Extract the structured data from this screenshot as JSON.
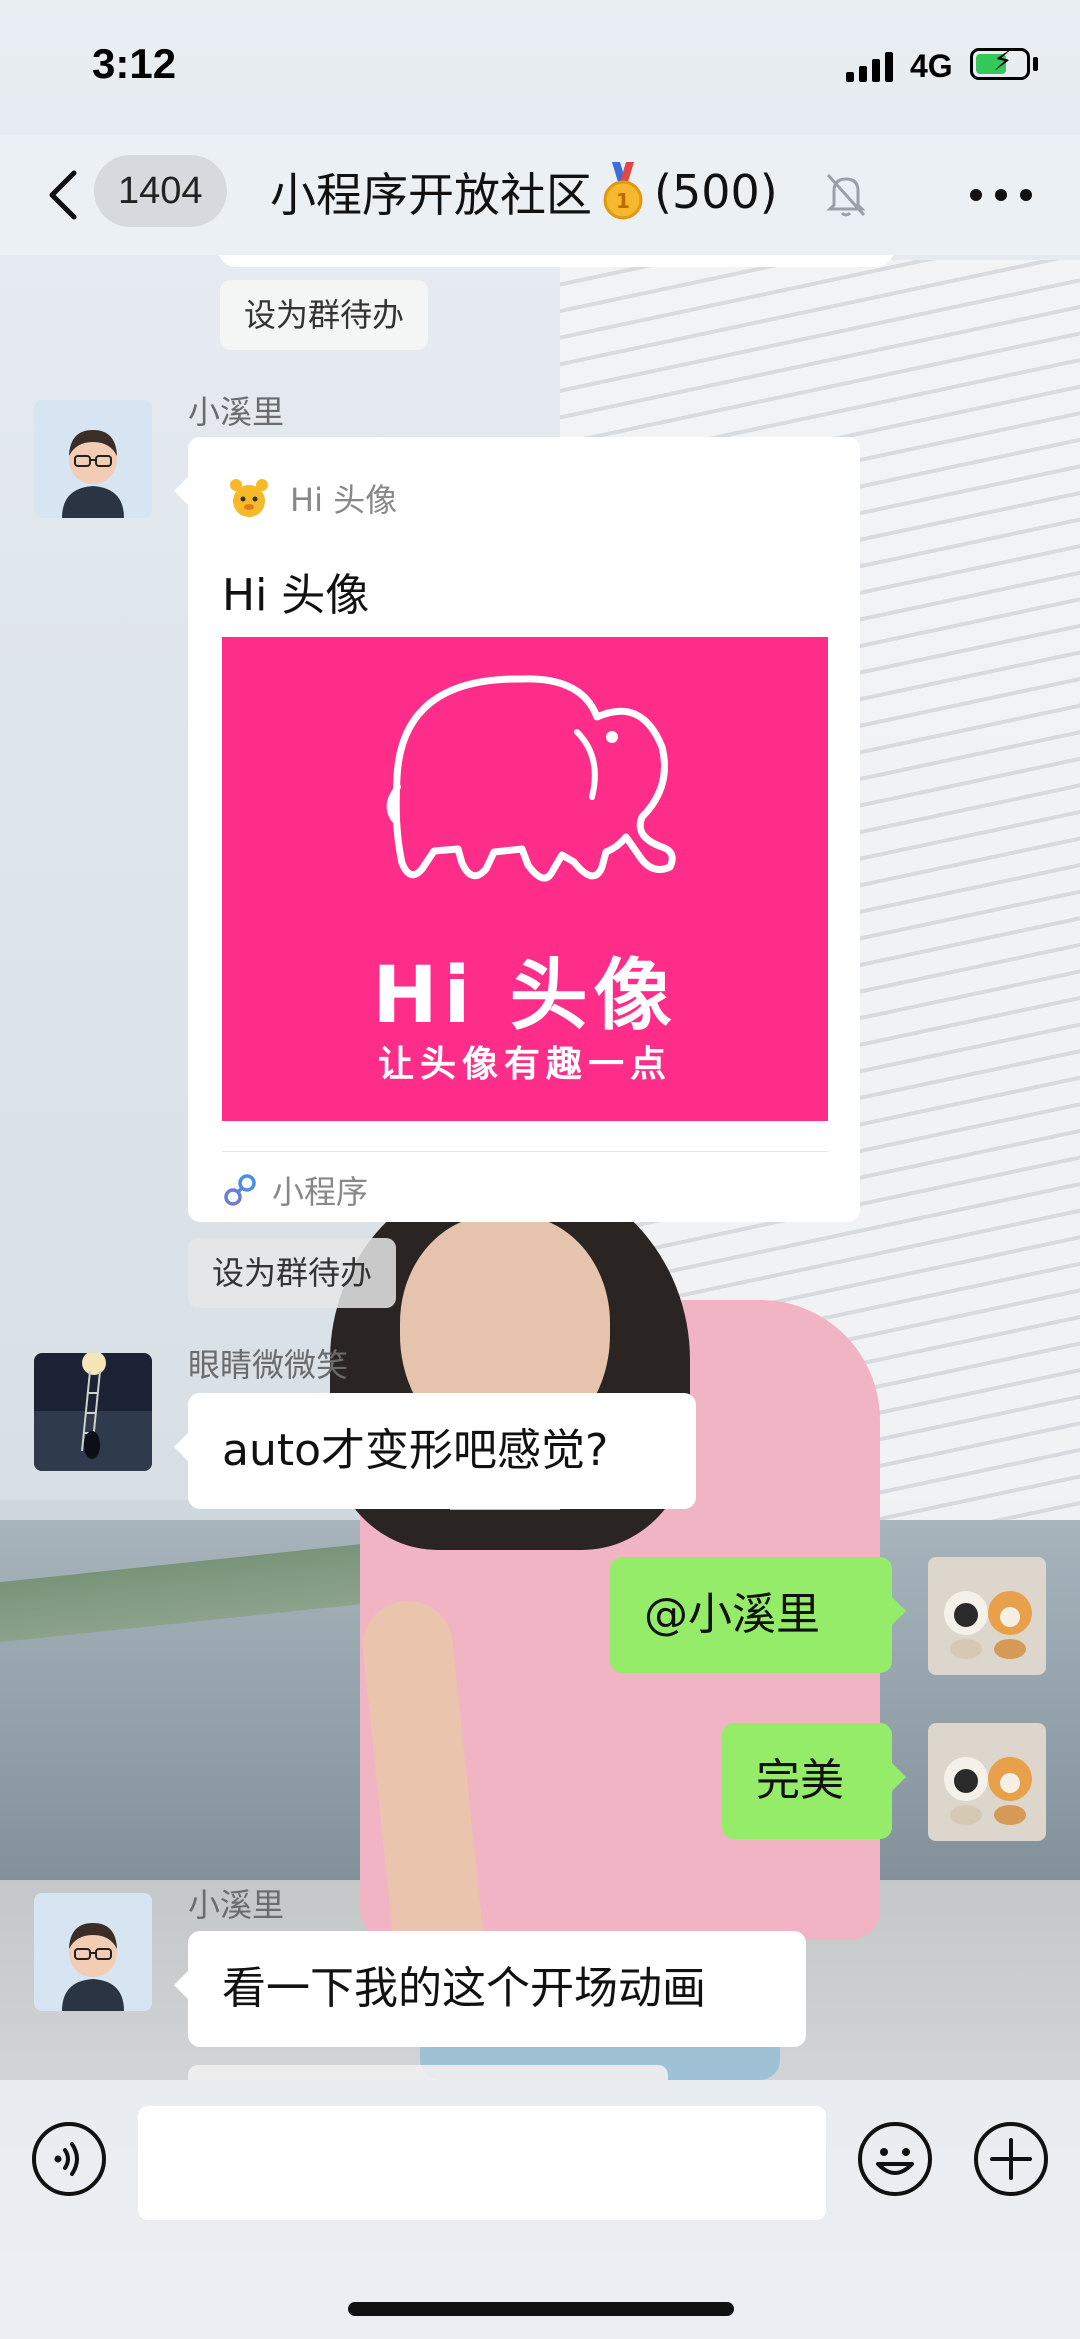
{
  "status_bar": {
    "time": "3:12",
    "network": "4G",
    "battery_level": 0.62,
    "charging": true
  },
  "nav": {
    "back_icon": "chevron-left-icon",
    "unread_count": "1404",
    "title": "小程序开放社区",
    "member_count": "(500)",
    "mute_icon": "bell-slash-icon",
    "more_icon": "more-dots-icon"
  },
  "chat": {
    "top_todo": "设为群待办",
    "card_message": {
      "sender": "小溪里",
      "source_name": "Hi 头像",
      "title": "Hi 头像",
      "poster_brand": "Hi 头像",
      "poster_slogan": "让头像有趣一点",
      "footer_label": "小程序",
      "todo": "设为群待办"
    },
    "messages": [
      {
        "sender": "眼睛微微笑",
        "text": "auto才变形吧感觉?",
        "side": "left"
      },
      {
        "sender": "",
        "text": "@小溪里",
        "side": "right"
      },
      {
        "sender": "",
        "text": "完美",
        "side": "right"
      },
      {
        "sender": "小溪里",
        "text": "看一下我的这个开场动画",
        "side": "left"
      }
    ]
  },
  "input_bar": {
    "voice_icon": "voice-icon",
    "emoji_icon": "emoji-icon",
    "plus_icon": "plus-icon",
    "text_value": ""
  },
  "colors": {
    "accent_pink": "#ff2d8a",
    "green_bubble": "#95ec69",
    "battery_green": "#34c759"
  }
}
